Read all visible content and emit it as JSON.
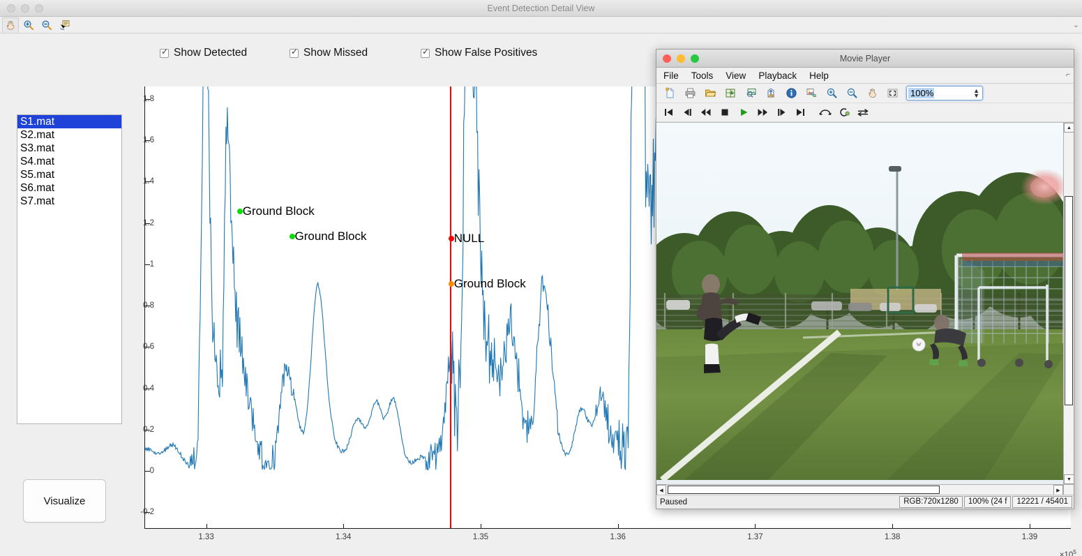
{
  "main_window": {
    "title": "Event Detection Detail View",
    "toolbar": [
      {
        "name": "pan-icon",
        "label": "Pan",
        "active": true
      },
      {
        "name": "zoom-in-icon",
        "label": "Zoom In",
        "active": false
      },
      {
        "name": "zoom-out-icon",
        "label": "Zoom Out",
        "active": false
      },
      {
        "name": "data-cursor-icon",
        "label": "Data Cursor",
        "active": false
      }
    ]
  },
  "controls": {
    "checkboxes": [
      {
        "name": "show-detected",
        "label": "Show Detected",
        "checked": true
      },
      {
        "name": "show-missed",
        "label": "Show Missed",
        "checked": true
      },
      {
        "name": "show-false-positives",
        "label": "Show False Positives",
        "checked": true
      }
    ],
    "visualize_label": "Visualize"
  },
  "file_list": {
    "items": [
      "S1.mat",
      "S2.mat",
      "S3.mat",
      "S4.mat",
      "S5.mat",
      "S6.mat",
      "S7.mat"
    ],
    "selected_index": 0,
    "selection_color": "#1f43d8"
  },
  "chart_data": {
    "type": "line",
    "title": "",
    "xlabel": "",
    "ylabel": "",
    "x_exponent_label": "×10",
    "x_exponent": "5",
    "xlim": [
      132550,
      139300
    ],
    "ylim": [
      -0.28,
      1.86
    ],
    "xticks": [
      1.33,
      1.34,
      1.35,
      1.36,
      1.37,
      1.38,
      1.39
    ],
    "xtick_labels": [
      "1.33",
      "1.34",
      "1.35",
      "1.36",
      "1.37",
      "1.38",
      "1.39"
    ],
    "yticks": [
      -0.2,
      0,
      0.2,
      0.4,
      0.6,
      0.8,
      1,
      1.2,
      1.4,
      1.6,
      1.8
    ],
    "ytick_labels": [
      "-0.2",
      "0",
      "0.2",
      "0.4",
      "0.6",
      "0.8",
      "1",
      "1.2",
      "1.4",
      "1.6",
      "1.8"
    ],
    "grid": false,
    "legend": "none",
    "series": [
      {
        "name": "signal",
        "color": "#1f77b4",
        "description": "Noisy accelerometer magnitude trace with sharp event spikes"
      }
    ],
    "cursor_line": {
      "name": "playhead",
      "x": 1.3477,
      "color": "#ff0000"
    },
    "annotations": [
      {
        "name": "detected-event-1",
        "label": "Ground Block",
        "x": 1.3324,
        "y": 1.255,
        "marker_color": "#00e000",
        "category": "detected"
      },
      {
        "name": "detected-event-2",
        "label": "Ground Block",
        "x": 1.3362,
        "y": 1.135,
        "marker_color": "#00e000",
        "category": "detected"
      },
      {
        "name": "false-positive-event",
        "label": "NULL",
        "x": 1.3478,
        "y": 1.125,
        "marker_color": "#ff0000",
        "category": "false_positive"
      },
      {
        "name": "missed-event",
        "label": "Ground Block",
        "x": 1.3478,
        "y": 0.905,
        "marker_color": "#ff8c00",
        "category": "missed"
      }
    ]
  },
  "movie_player": {
    "title": "Movie Player",
    "menus": [
      "File",
      "Tools",
      "View",
      "Playback",
      "Help"
    ],
    "toolbar": [
      {
        "name": "new-file-icon",
        "label": "New"
      },
      {
        "name": "print-icon",
        "label": "Print"
      },
      {
        "name": "open-folder-icon",
        "label": "Open"
      },
      {
        "name": "import-data-icon",
        "label": "Import Data"
      },
      {
        "name": "export-image-icon",
        "label": "Export"
      },
      {
        "name": "send-to-figure-icon",
        "label": "Send to Figure"
      },
      {
        "name": "info-icon",
        "label": "Video Information"
      },
      {
        "name": "colormap-icon",
        "label": "Colormap"
      },
      {
        "name": "zoom-in-icon",
        "label": "Zoom In"
      },
      {
        "name": "zoom-out-icon",
        "label": "Zoom Out"
      },
      {
        "name": "pan-icon",
        "label": "Pan"
      },
      {
        "name": "fit-to-window-icon",
        "label": "Maximize / Fit to Window"
      }
    ],
    "zoom_value": "100%",
    "transport": [
      {
        "name": "go-to-start-button",
        "label": "Go to start"
      },
      {
        "name": "step-back-button",
        "label": "Step back"
      },
      {
        "name": "rewind-button",
        "label": "Rewind"
      },
      {
        "name": "stop-button",
        "label": "Stop"
      },
      {
        "name": "play-button",
        "label": "Play"
      },
      {
        "name": "fast-forward-button",
        "label": "Fast forward"
      },
      {
        "name": "step-forward-button",
        "label": "Step forward"
      },
      {
        "name": "go-to-end-button",
        "label": "Go to end"
      },
      {
        "name": "jump-to-button",
        "label": "Jump to"
      },
      {
        "name": "repeat-button",
        "label": "Repeat"
      },
      {
        "name": "playback-mode-button",
        "label": "Playback mode"
      }
    ],
    "status": {
      "state": "Paused",
      "format": "RGB:720x1280",
      "rate": "100% (24 f",
      "frame": "12221 / 45401"
    },
    "video_scene": "Outdoor soccer pitch: a player kicking a ball toward a goal, goalkeeper diving, trees and fence in background"
  }
}
